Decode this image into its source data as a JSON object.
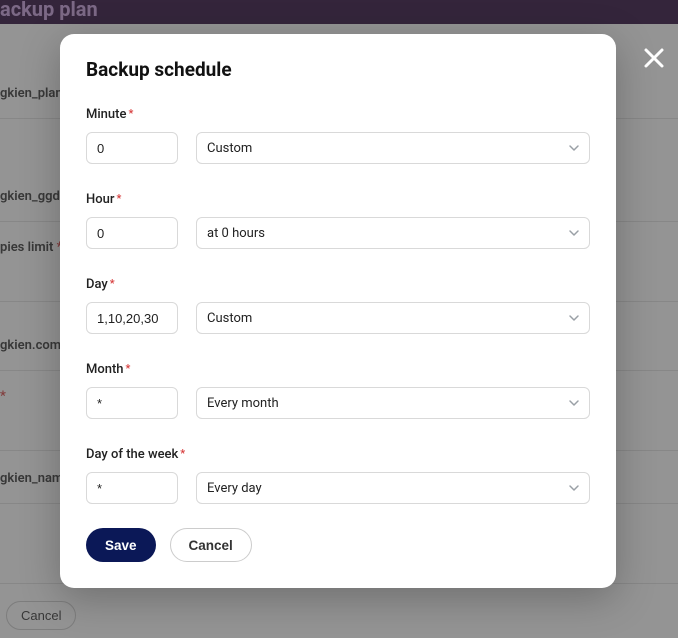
{
  "background": {
    "page_title_partial": "ackup plan",
    "labels": {
      "l1": "gkien_plan",
      "l2": "gkien_ggdi",
      "l3_prefix": "pies limit",
      "l4": "gkien.com",
      "l5": "gkien_nam"
    },
    "required_marker": "*",
    "cancel_label": "Cancel"
  },
  "modal": {
    "title": "Backup schedule",
    "fields": {
      "minute": {
        "label": "Minute",
        "value": "0",
        "select": "Custom"
      },
      "hour": {
        "label": "Hour",
        "value": "0",
        "select": "at 0 hours"
      },
      "day": {
        "label": "Day",
        "value": "1,10,20,30",
        "select": "Custom"
      },
      "month": {
        "label": "Month",
        "value": "*",
        "select": "Every month"
      },
      "dow": {
        "label": "Day of the week",
        "value": "*",
        "select": "Every day"
      }
    },
    "buttons": {
      "save": "Save",
      "cancel": "Cancel"
    }
  }
}
